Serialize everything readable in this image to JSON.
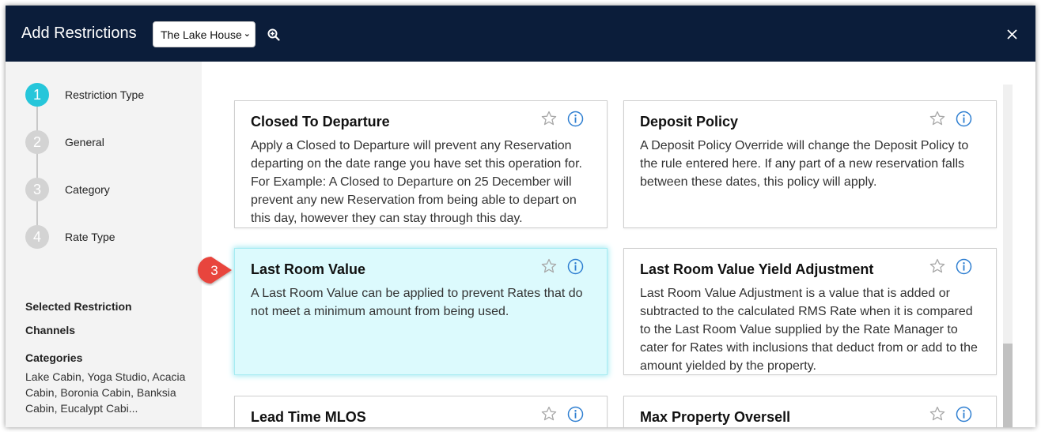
{
  "header": {
    "title": "Add Restrictions",
    "property_select": "The Lake House"
  },
  "steps": [
    {
      "number": "1",
      "label": "Restriction Type"
    },
    {
      "number": "2",
      "label": "General"
    },
    {
      "number": "3",
      "label": "Category"
    },
    {
      "number": "4",
      "label": "Rate Type"
    }
  ],
  "summary": {
    "selected_restriction": "Selected Restriction",
    "channels": "Channels",
    "categories_heading": "Categories",
    "categories_value": "Lake Cabin, Yoga Studio, Acacia Cabin, Boronia Cabin, Banksia Cabin, Eucalypt Cabi..."
  },
  "cards": [
    {
      "title": "Closed To Departure",
      "desc": "Apply a Closed to Departure will prevent any Reservation departing on the date range you have set this operation for. For Example: A Closed to Departure on 25 December will prevent any new Reservation from being able to depart on this day, however they can stay through this day."
    },
    {
      "title": "Deposit Policy",
      "desc": "A Deposit Policy Override will change the Deposit Policy to the rule entered here. If any part of a new reservation falls between these dates, this policy will apply."
    },
    {
      "title": "Last Room Value",
      "desc": "A Last Room Value can be applied to prevent Rates that do not meet a minimum amount from being used."
    },
    {
      "title": "Last Room Value Yield Adjustment",
      "desc": "Last Room Value Adjustment is a value that is added or subtracted to the calculated RMS Rate when it is compared to the Last Room Value supplied by the Rate Manager to cater for Rates with inclusions that deduct from or add to the amount yielded by the property."
    },
    {
      "title": "Lead Time MLOS",
      "desc": ""
    },
    {
      "title": "Max Property Oversell",
      "desc": ""
    }
  ],
  "annotation": {
    "number": "3"
  },
  "colors": {
    "header_bg": "#0b1d3a",
    "active_step": "#26c6da",
    "selected_card_bg": "#dcfafd",
    "info_icon": "#2f7fd1",
    "annotation_badge": "#e8453c"
  },
  "icons": {
    "zoom": "zoom-in-icon",
    "close": "close-icon",
    "star": "star-outline-icon",
    "info": "info-circle-icon"
  }
}
